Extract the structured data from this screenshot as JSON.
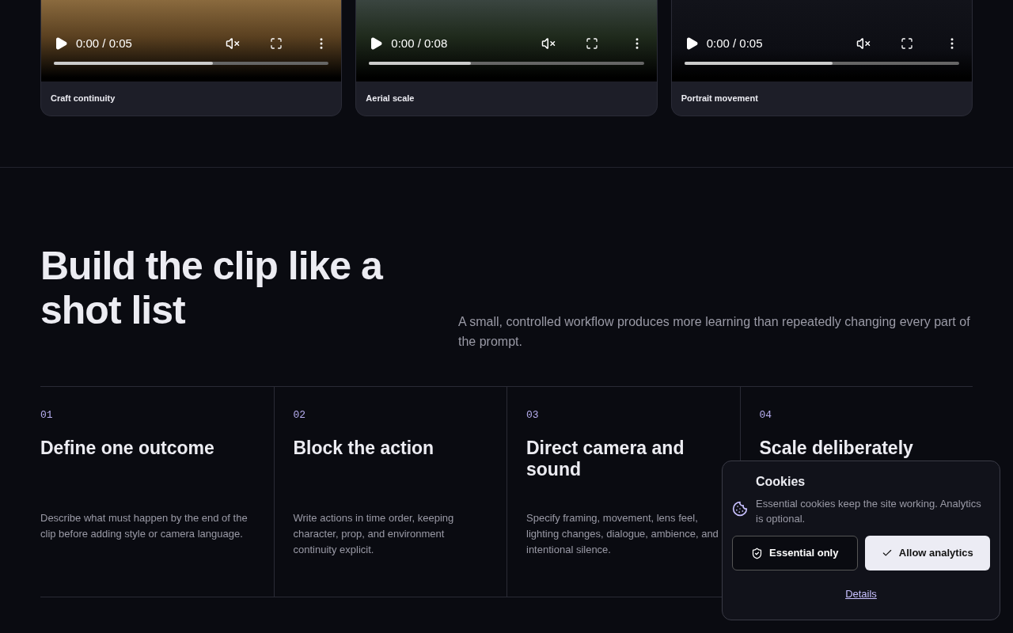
{
  "videos": [
    {
      "time": "0:00 / 0:05",
      "muted": true,
      "level": 0.58,
      "caption": "Craft continuity"
    },
    {
      "time": "0:00 / 0:08",
      "muted": true,
      "level": 0.37,
      "caption": "Aerial scale"
    },
    {
      "time": "0:00 / 0:05",
      "muted": true,
      "level": 0.54,
      "caption": "Portrait movement"
    }
  ],
  "section": {
    "heading": "Build the clip like a shot list",
    "intro": "A small, controlled workflow produces more learning than repeatedly changing every part of the prompt."
  },
  "steps": [
    {
      "number": "01",
      "title": "Define one outcome",
      "body": "Describe what must happen by the end of the clip before adding style or camera language."
    },
    {
      "number": "02",
      "title": "Block the action",
      "body": "Write actions in time order, keeping character, prop, and environment continuity explicit."
    },
    {
      "number": "03",
      "title": "Direct camera and sound",
      "body": "Specify framing, movement, lens feel, lighting changes, dialogue, ambience, and intentional silence."
    },
    {
      "number": "04",
      "title": "Scale deliberately"
    }
  ],
  "cookie_banner": {
    "title": "Cookies",
    "text": "Essential cookies keep the site working. Analytics is optional.",
    "buttons": [
      {
        "label": "Essential only",
        "kind": "secondary"
      },
      {
        "label": "Allow analytics",
        "kind": "primary"
      }
    ],
    "link": "Details"
  }
}
